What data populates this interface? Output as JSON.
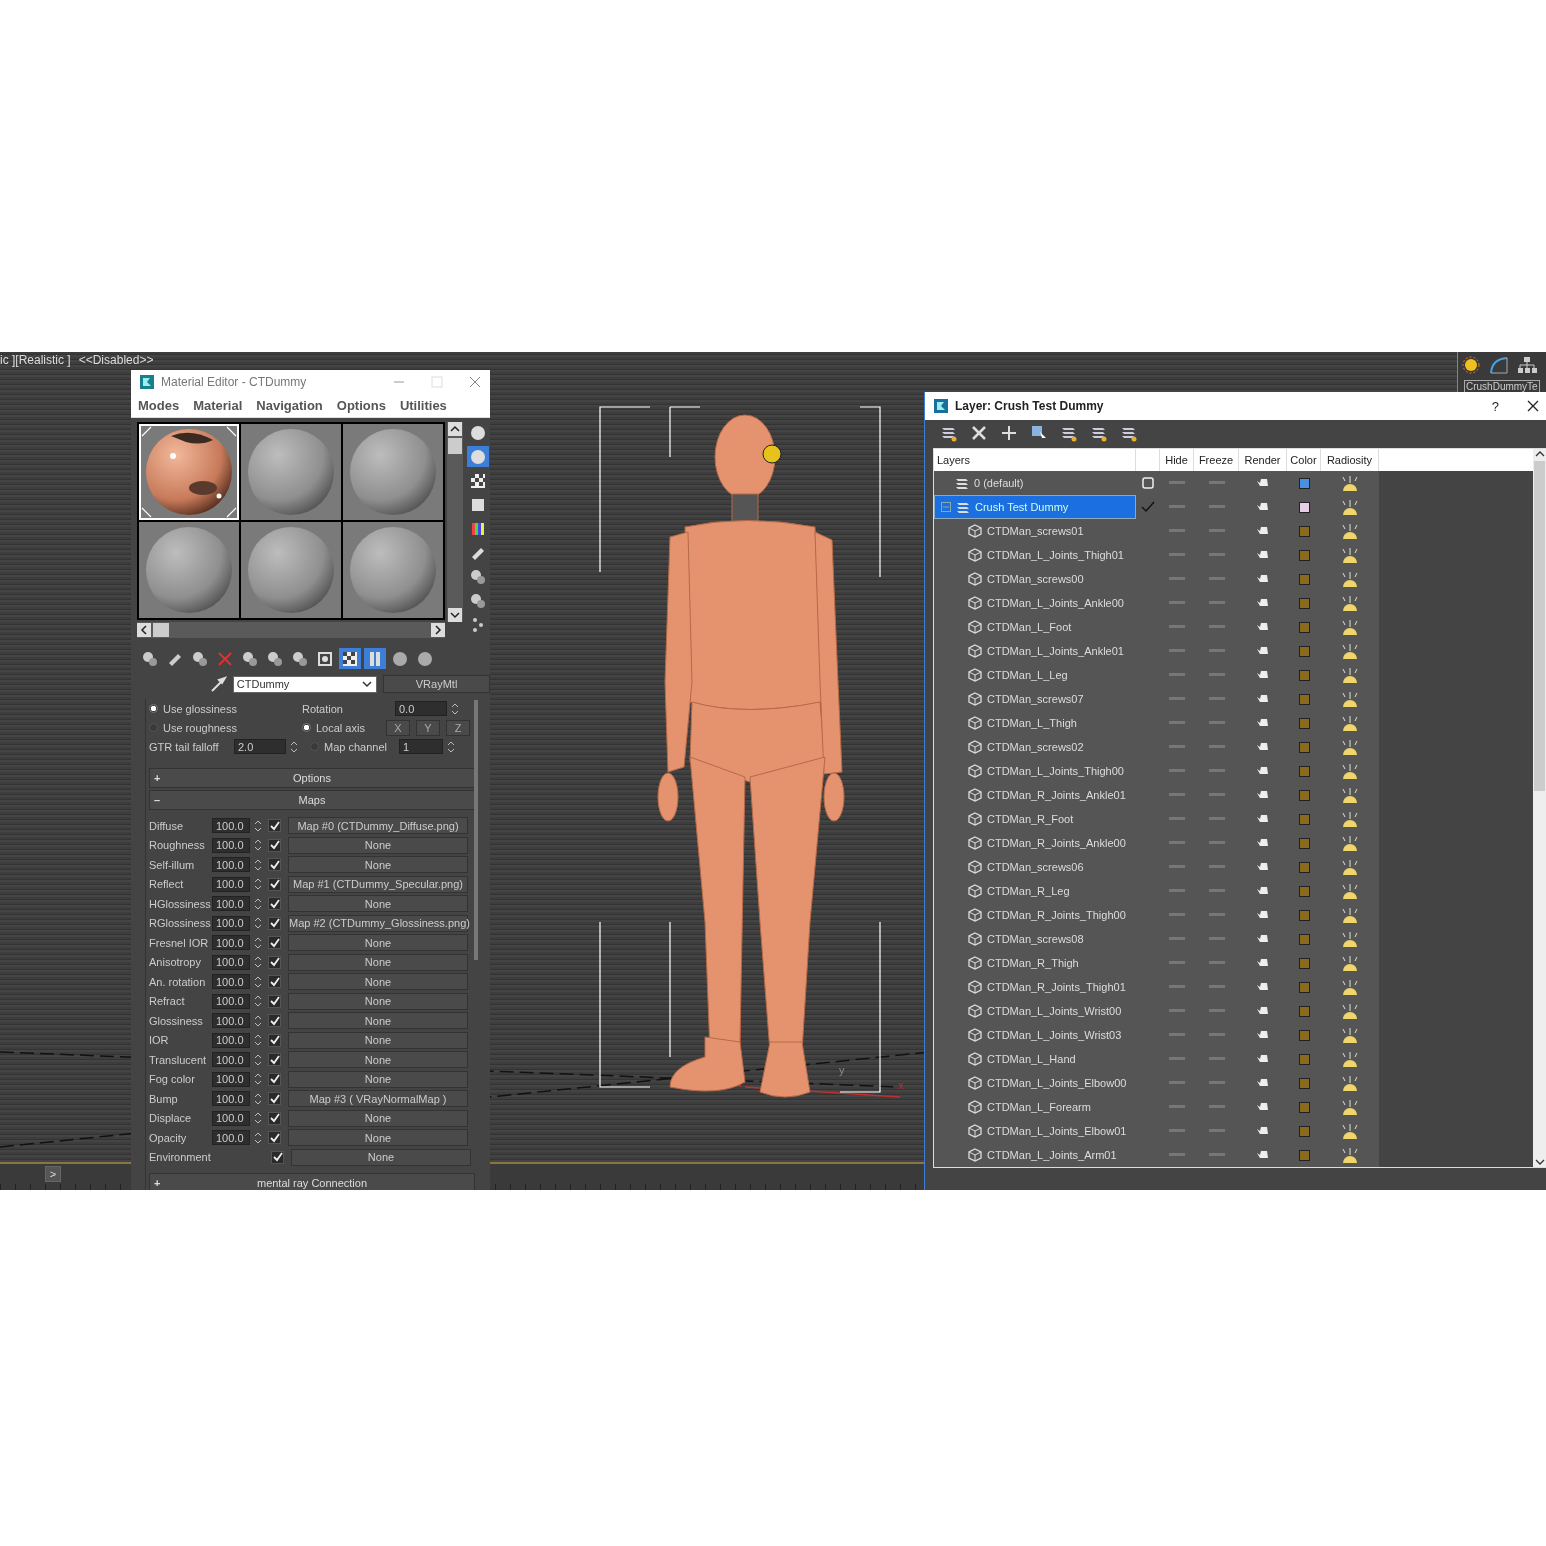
{
  "viewport": {
    "label": "ic ][Realistic ]",
    "status": "<<Disabled>>",
    "axis_labels": [
      "y",
      "x"
    ],
    "bottom_button": ">"
  },
  "top_right": {
    "field": "CrushDummyTe"
  },
  "material_editor": {
    "title": "Material Editor - CTDummy",
    "menus": [
      "Modes",
      "Material",
      "Navigation",
      "Options",
      "Utilities"
    ],
    "slots": [
      {
        "kind": "textured",
        "selected": true
      },
      {
        "kind": "plain",
        "selected": false
      },
      {
        "kind": "plain",
        "selected": false
      },
      {
        "kind": "plain",
        "selected": false
      },
      {
        "kind": "plain",
        "selected": false
      },
      {
        "kind": "plain",
        "selected": false
      }
    ],
    "side_tools": [
      {
        "on": false
      },
      {
        "on": true
      },
      {
        "on": false
      },
      {
        "on": false
      },
      {
        "on": false
      },
      {
        "on": false
      },
      {
        "on": false
      },
      {
        "on": false
      },
      {
        "on": false
      }
    ],
    "tools": [
      {
        "on": false
      },
      {
        "on": false
      },
      {
        "on": false
      },
      {
        "on": false
      },
      {
        "on": false
      },
      {
        "on": false
      },
      {
        "on": false
      },
      {
        "on": false
      },
      {
        "on": true
      },
      {
        "on": true
      },
      {
        "on": false
      },
      {
        "on": false
      }
    ],
    "material_name": "CTDummy",
    "material_type": "VRayMtl",
    "radios": [
      {
        "label": "Use glossiness",
        "selected": true
      },
      {
        "label": "Use roughness",
        "selected": false
      }
    ],
    "rotation": {
      "label": "Rotation",
      "value": "0.0"
    },
    "axis_radios": [
      {
        "label": "Local axis",
        "selected": true
      },
      {
        "label": "Map channel",
        "selected": false
      }
    ],
    "axes": [
      "X",
      "Y",
      "Z"
    ],
    "gtr": {
      "label": "GTR tail falloff",
      "value": "2.0"
    },
    "map_channel": "1",
    "rollouts": [
      {
        "sign": "+",
        "title": "Options"
      },
      {
        "sign": "–",
        "title": "Maps"
      }
    ],
    "maps": [
      {
        "label": "Diffuse",
        "amount": "100.0",
        "checked": true,
        "map": "Map #0 (CTDummy_Diffuse.png)"
      },
      {
        "label": "Roughness",
        "amount": "100.0",
        "checked": true,
        "map": "None"
      },
      {
        "label": "Self-illum",
        "amount": "100.0",
        "checked": true,
        "map": "None"
      },
      {
        "label": "Reflect",
        "amount": "100.0",
        "checked": true,
        "map": "Map #1 (CTDummy_Specular.png)"
      },
      {
        "label": "HGlossiness",
        "amount": "100.0",
        "checked": true,
        "map": "None"
      },
      {
        "label": "RGlossiness",
        "amount": "100.0",
        "checked": true,
        "map": "Map #2 (CTDummy_Glossiness.png)"
      },
      {
        "label": "Fresnel IOR",
        "amount": "100.0",
        "checked": true,
        "map": "None"
      },
      {
        "label": "Anisotropy",
        "amount": "100.0",
        "checked": true,
        "map": "None"
      },
      {
        "label": "An. rotation",
        "amount": "100.0",
        "checked": true,
        "map": "None"
      },
      {
        "label": "Refract",
        "amount": "100.0",
        "checked": true,
        "map": "None"
      },
      {
        "label": "Glossiness",
        "amount": "100.0",
        "checked": true,
        "map": "None"
      },
      {
        "label": "IOR",
        "amount": "100.0",
        "checked": true,
        "map": "None"
      },
      {
        "label": "Translucent",
        "amount": "100.0",
        "checked": true,
        "map": "None"
      },
      {
        "label": "Fog color",
        "amount": "100.0",
        "checked": true,
        "map": "None"
      },
      {
        "label": "Bump",
        "amount": "100.0",
        "checked": true,
        "map": "Map #3  ( VRayNormalMap )"
      },
      {
        "label": "Displace",
        "amount": "100.0",
        "checked": true,
        "map": "None"
      },
      {
        "label": "Opacity",
        "amount": "100.0",
        "checked": true,
        "map": "None"
      },
      {
        "label": "Environment",
        "checked": true,
        "map": "None"
      }
    ],
    "next_rollout": {
      "sign": "+",
      "title": "mental ray Connection"
    }
  },
  "layer_window": {
    "title": "Layer: Crush Test Dummy",
    "help": "?",
    "header": {
      "name": "Layers",
      "columns": [
        "Hide",
        "Freeze",
        "Render",
        "Color",
        "Radiosity"
      ]
    },
    "layers": [
      {
        "name": "0 (default)",
        "active": false,
        "selected": false,
        "color": "#4a8fe0"
      },
      {
        "name": "Crush Test Dummy",
        "active": true,
        "selected": true,
        "expanded": true,
        "color": "#e6cfe6",
        "children": [
          {
            "name": "CTDMan_screws01",
            "color": "#8a6a1c"
          },
          {
            "name": "CTDMan_L_Joints_Thigh01",
            "color": "#8a6a1c"
          },
          {
            "name": "CTDMan_screws00",
            "color": "#8a6a1c"
          },
          {
            "name": "CTDMan_L_Joints_Ankle00",
            "color": "#8a6a1c"
          },
          {
            "name": "CTDMan_L_Foot",
            "color": "#8a6a1c"
          },
          {
            "name": "CTDMan_L_Joints_Ankle01",
            "color": "#8a6a1c"
          },
          {
            "name": "CTDMan_L_Leg",
            "color": "#8a6a1c"
          },
          {
            "name": "CTDMan_screws07",
            "color": "#8a6a1c"
          },
          {
            "name": "CTDMan_L_Thigh",
            "color": "#8a6a1c"
          },
          {
            "name": "CTDMan_screws02",
            "color": "#8a6a1c"
          },
          {
            "name": "CTDMan_L_Joints_Thigh00",
            "color": "#8a6a1c"
          },
          {
            "name": "CTDMan_R_Joints_Ankle01",
            "color": "#8a6a1c"
          },
          {
            "name": "CTDMan_R_Foot",
            "color": "#8a6a1c"
          },
          {
            "name": "CTDMan_R_Joints_Ankle00",
            "color": "#8a6a1c"
          },
          {
            "name": "CTDMan_screws06",
            "color": "#8a6a1c"
          },
          {
            "name": "CTDMan_R_Leg",
            "color": "#8a6a1c"
          },
          {
            "name": "CTDMan_R_Joints_Thigh00",
            "color": "#8a6a1c"
          },
          {
            "name": "CTDMan_screws08",
            "color": "#8a6a1c"
          },
          {
            "name": "CTDMan_R_Thigh",
            "color": "#8a6a1c"
          },
          {
            "name": "CTDMan_R_Joints_Thigh01",
            "color": "#8a6a1c"
          },
          {
            "name": "CTDMan_L_Joints_Wrist00",
            "color": "#8a6a1c"
          },
          {
            "name": "CTDMan_L_Joints_Wrist03",
            "color": "#8a6a1c"
          },
          {
            "name": "CTDMan_L_Hand",
            "color": "#8a6a1c"
          },
          {
            "name": "CTDMan_L_Joints_Elbow00",
            "color": "#8a6a1c"
          },
          {
            "name": "CTDMan_L_Forearm",
            "color": "#8a6a1c"
          },
          {
            "name": "CTDMan_L_Joints_Elbow01",
            "color": "#8a6a1c"
          },
          {
            "name": "CTDMan_L_Joints_Arm01",
            "color": "#8a6a1c"
          }
        ]
      }
    ]
  }
}
